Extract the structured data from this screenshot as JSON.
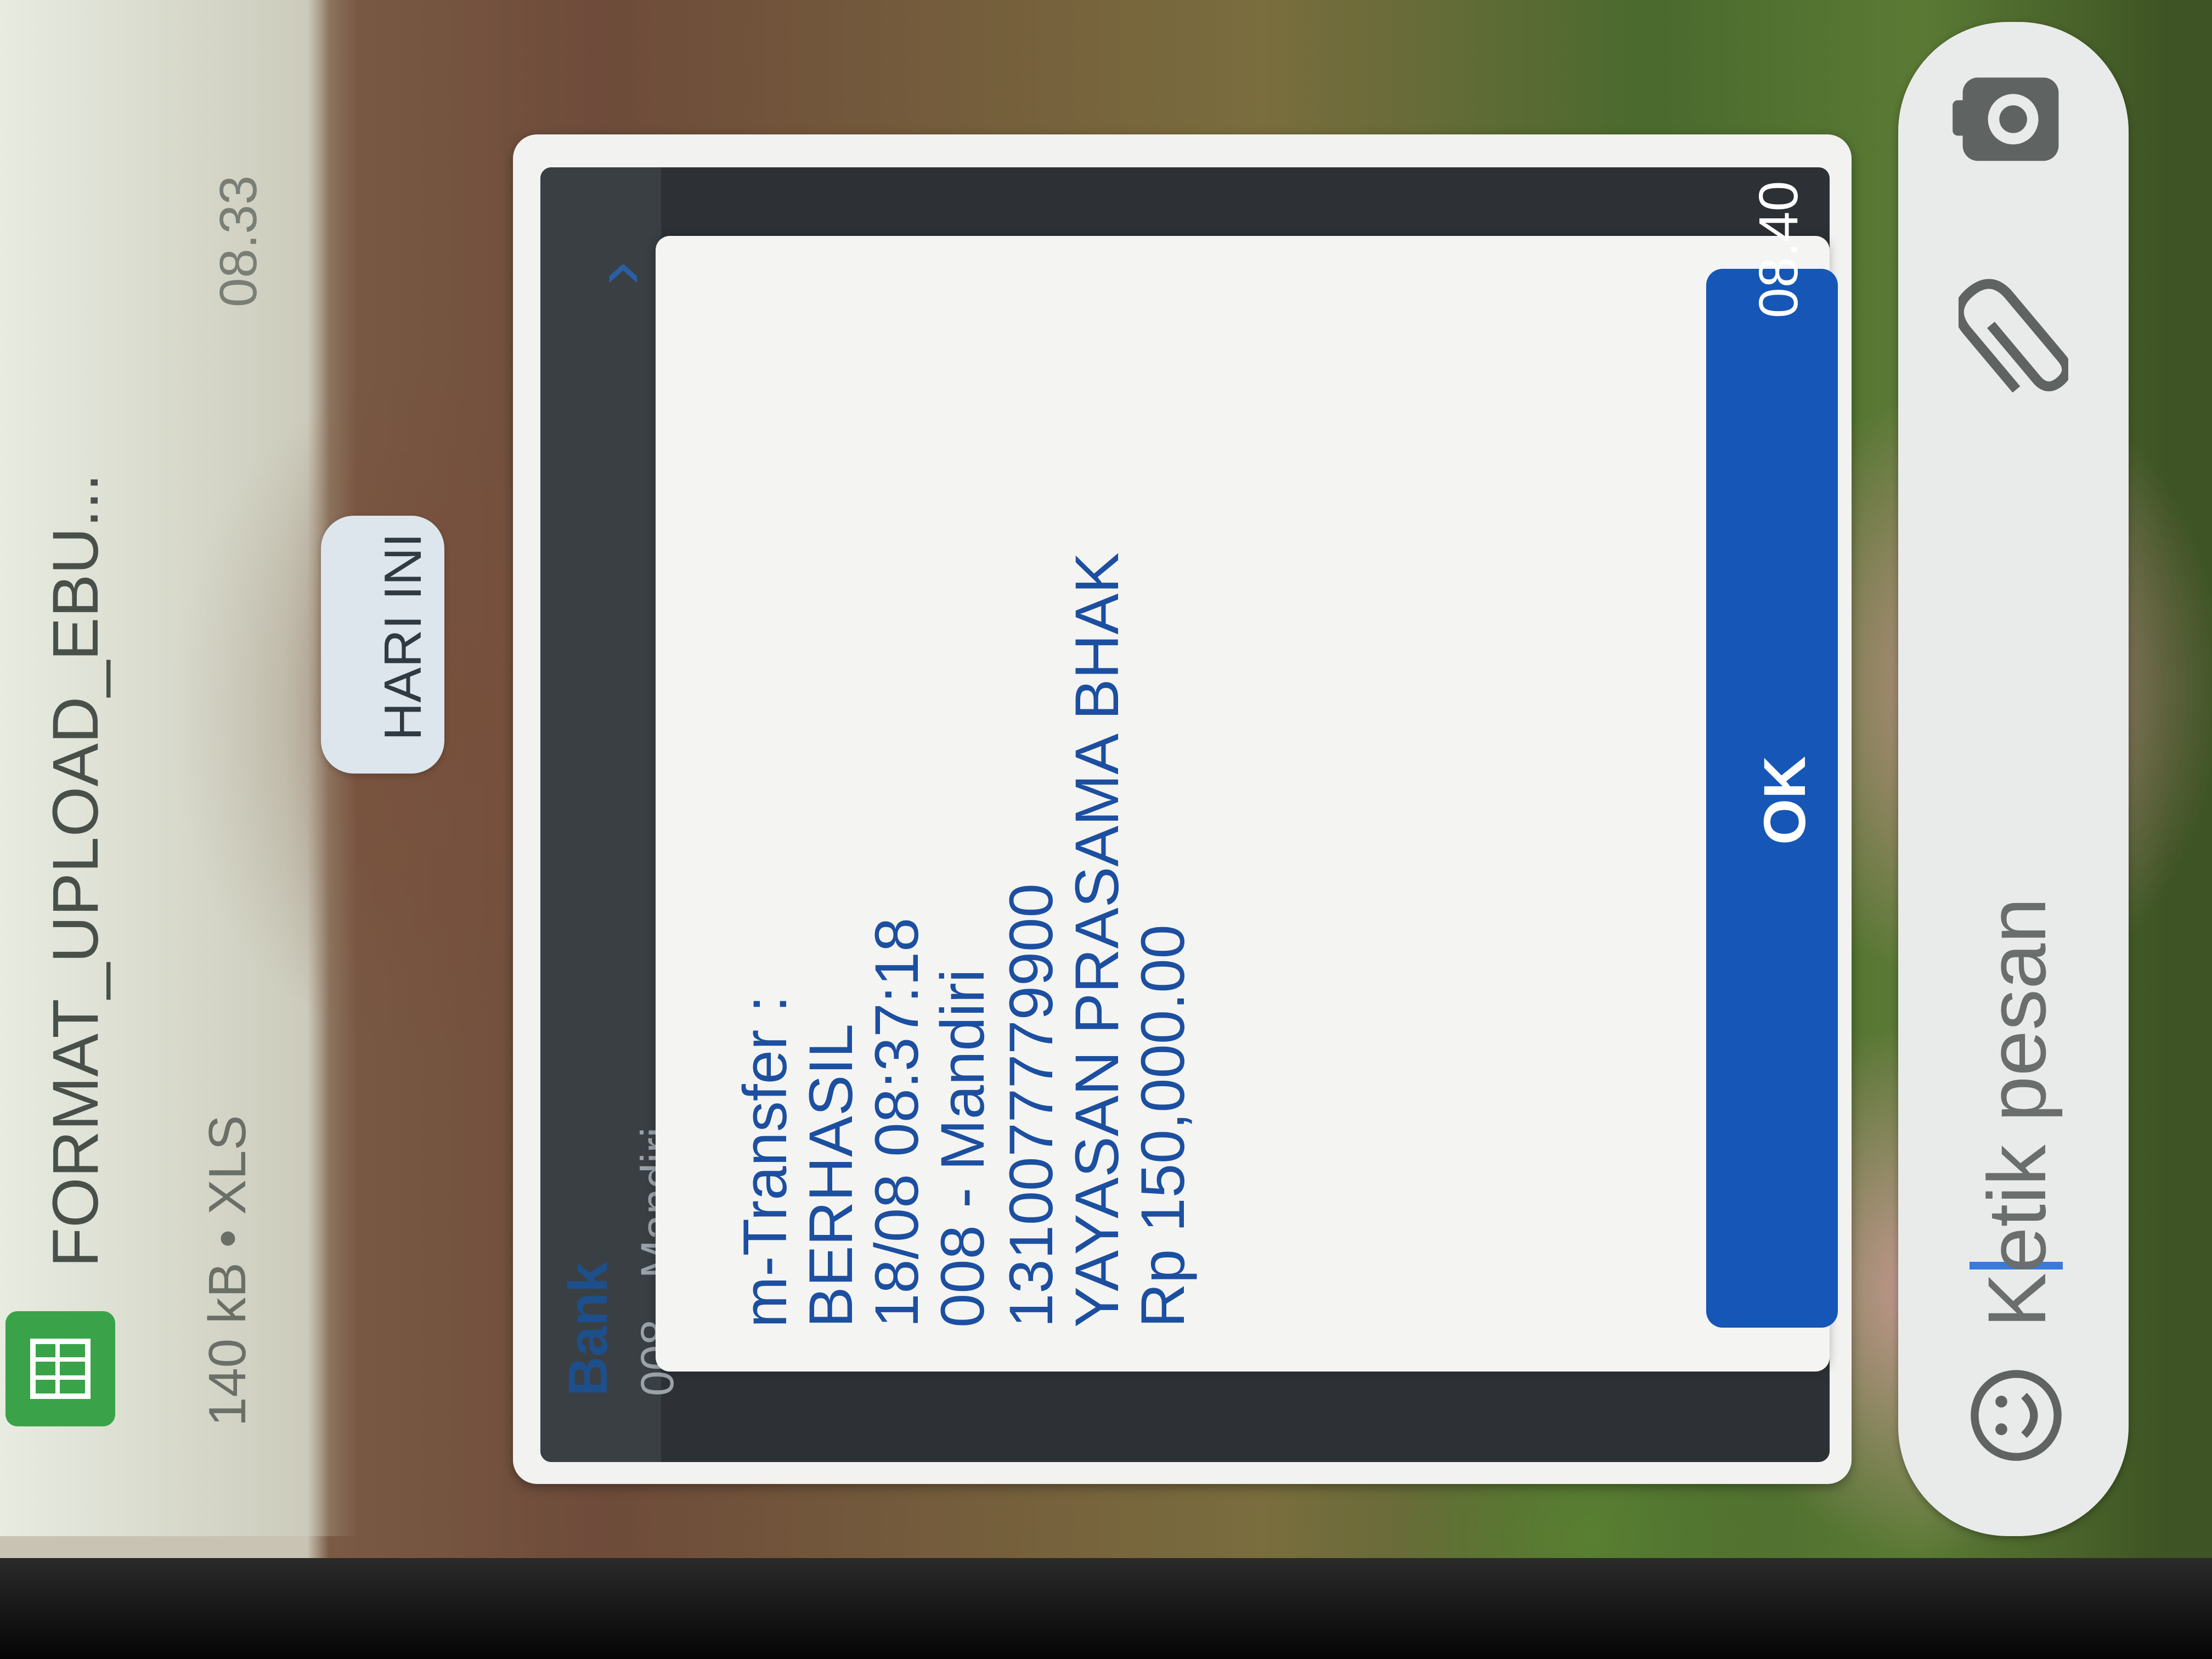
{
  "file_message": {
    "name": "FORMAT_UPLOAD_EBU...",
    "meta": "140 kB • XLS",
    "time": "08.33",
    "icon": "spreadsheet-icon"
  },
  "date_divider": "HARI INI",
  "image_message": {
    "screenshot": {
      "header_label": "Bank",
      "header_value": "008 - Mandiri",
      "dialog": {
        "lines": [
          "m-Transfer :",
          "BERHASIL",
          "18/08 08:37:18",
          "008 - Mandiri",
          "1310077779900",
          "YAYASAN PRASAMA BHAK",
          "Rp 150,000.00"
        ],
        "ok_label": "OK"
      }
    },
    "time": "08.40"
  },
  "composer": {
    "placeholder": "Ketik pesan",
    "icons": [
      "emoji-icon",
      "attach-icon",
      "camera-icon"
    ]
  },
  "colors": {
    "accent": "#1656b6",
    "dialog_text": "#1c4fa0",
    "file_icon": "#3aa34a"
  }
}
